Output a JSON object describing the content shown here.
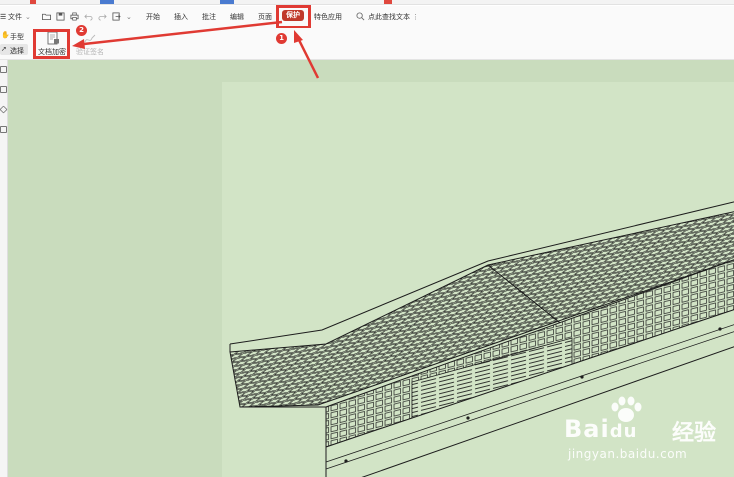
{
  "menubar": {
    "file_label": "文件",
    "tabs": [
      {
        "id": "start",
        "label": "开始"
      },
      {
        "id": "insert",
        "label": "插入"
      },
      {
        "id": "comment",
        "label": "批注"
      },
      {
        "id": "edit",
        "label": "编辑"
      },
      {
        "id": "page",
        "label": "页面"
      },
      {
        "id": "protect",
        "label": "保护"
      },
      {
        "id": "special",
        "label": "特色应用"
      }
    ],
    "search_label": "点此查找文本",
    "active_tab": "保护"
  },
  "ribbon": {
    "hand_label": "手型",
    "select_label": "选择",
    "encrypt_label": "文档加密",
    "verify_sign_label": "验证签名"
  },
  "annotations": {
    "step1": "1",
    "step2": "2",
    "color": "#e03a33"
  },
  "watermark": {
    "brand": "Bai",
    "brand_suffix": "du",
    "cn": "经验",
    "url": "jingyan.baidu.com"
  },
  "colors": {
    "canvas_bg": "#c9dcbd",
    "page_bg": "#d2e4c6",
    "protect_tab_bg": "#c0392b"
  }
}
